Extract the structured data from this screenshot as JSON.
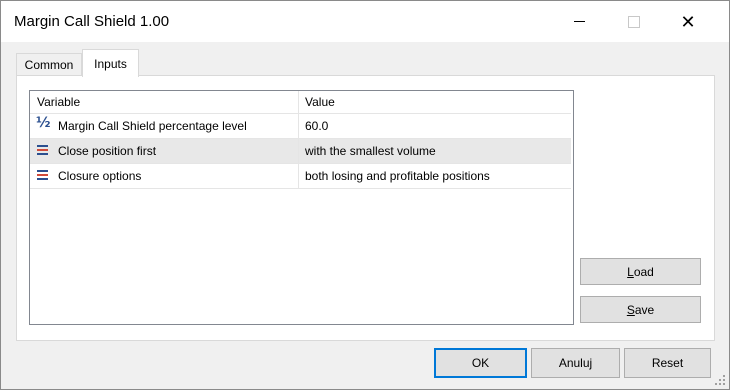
{
  "window": {
    "title": "Margin Call Shield 1.00"
  },
  "tabs": [
    {
      "label": "Common",
      "active": false
    },
    {
      "label": "Inputs",
      "active": true
    }
  ],
  "grid": {
    "columns": {
      "variable": "Variable",
      "value": "Value"
    },
    "rows": [
      {
        "icon": "fraction-half-icon",
        "variable": "Margin Call Shield percentage level",
        "value": "60.0",
        "selected": false
      },
      {
        "icon": "enum-list-icon",
        "variable": "Close position first",
        "value": "with the smallest volume",
        "selected": true
      },
      {
        "icon": "enum-list-icon",
        "variable": "Closure options",
        "value": "both losing and profitable positions",
        "selected": false
      }
    ]
  },
  "side_buttons": {
    "load_first": "L",
    "load_rest": "oad",
    "save_first": "S",
    "save_rest": "ave"
  },
  "footer": {
    "ok": "OK",
    "cancel": "Anuluj",
    "reset": "Reset"
  },
  "colors": {
    "accent": "#0078d7",
    "icon_blue": "#2b4f8f",
    "icon_red": "#d04a3a"
  }
}
